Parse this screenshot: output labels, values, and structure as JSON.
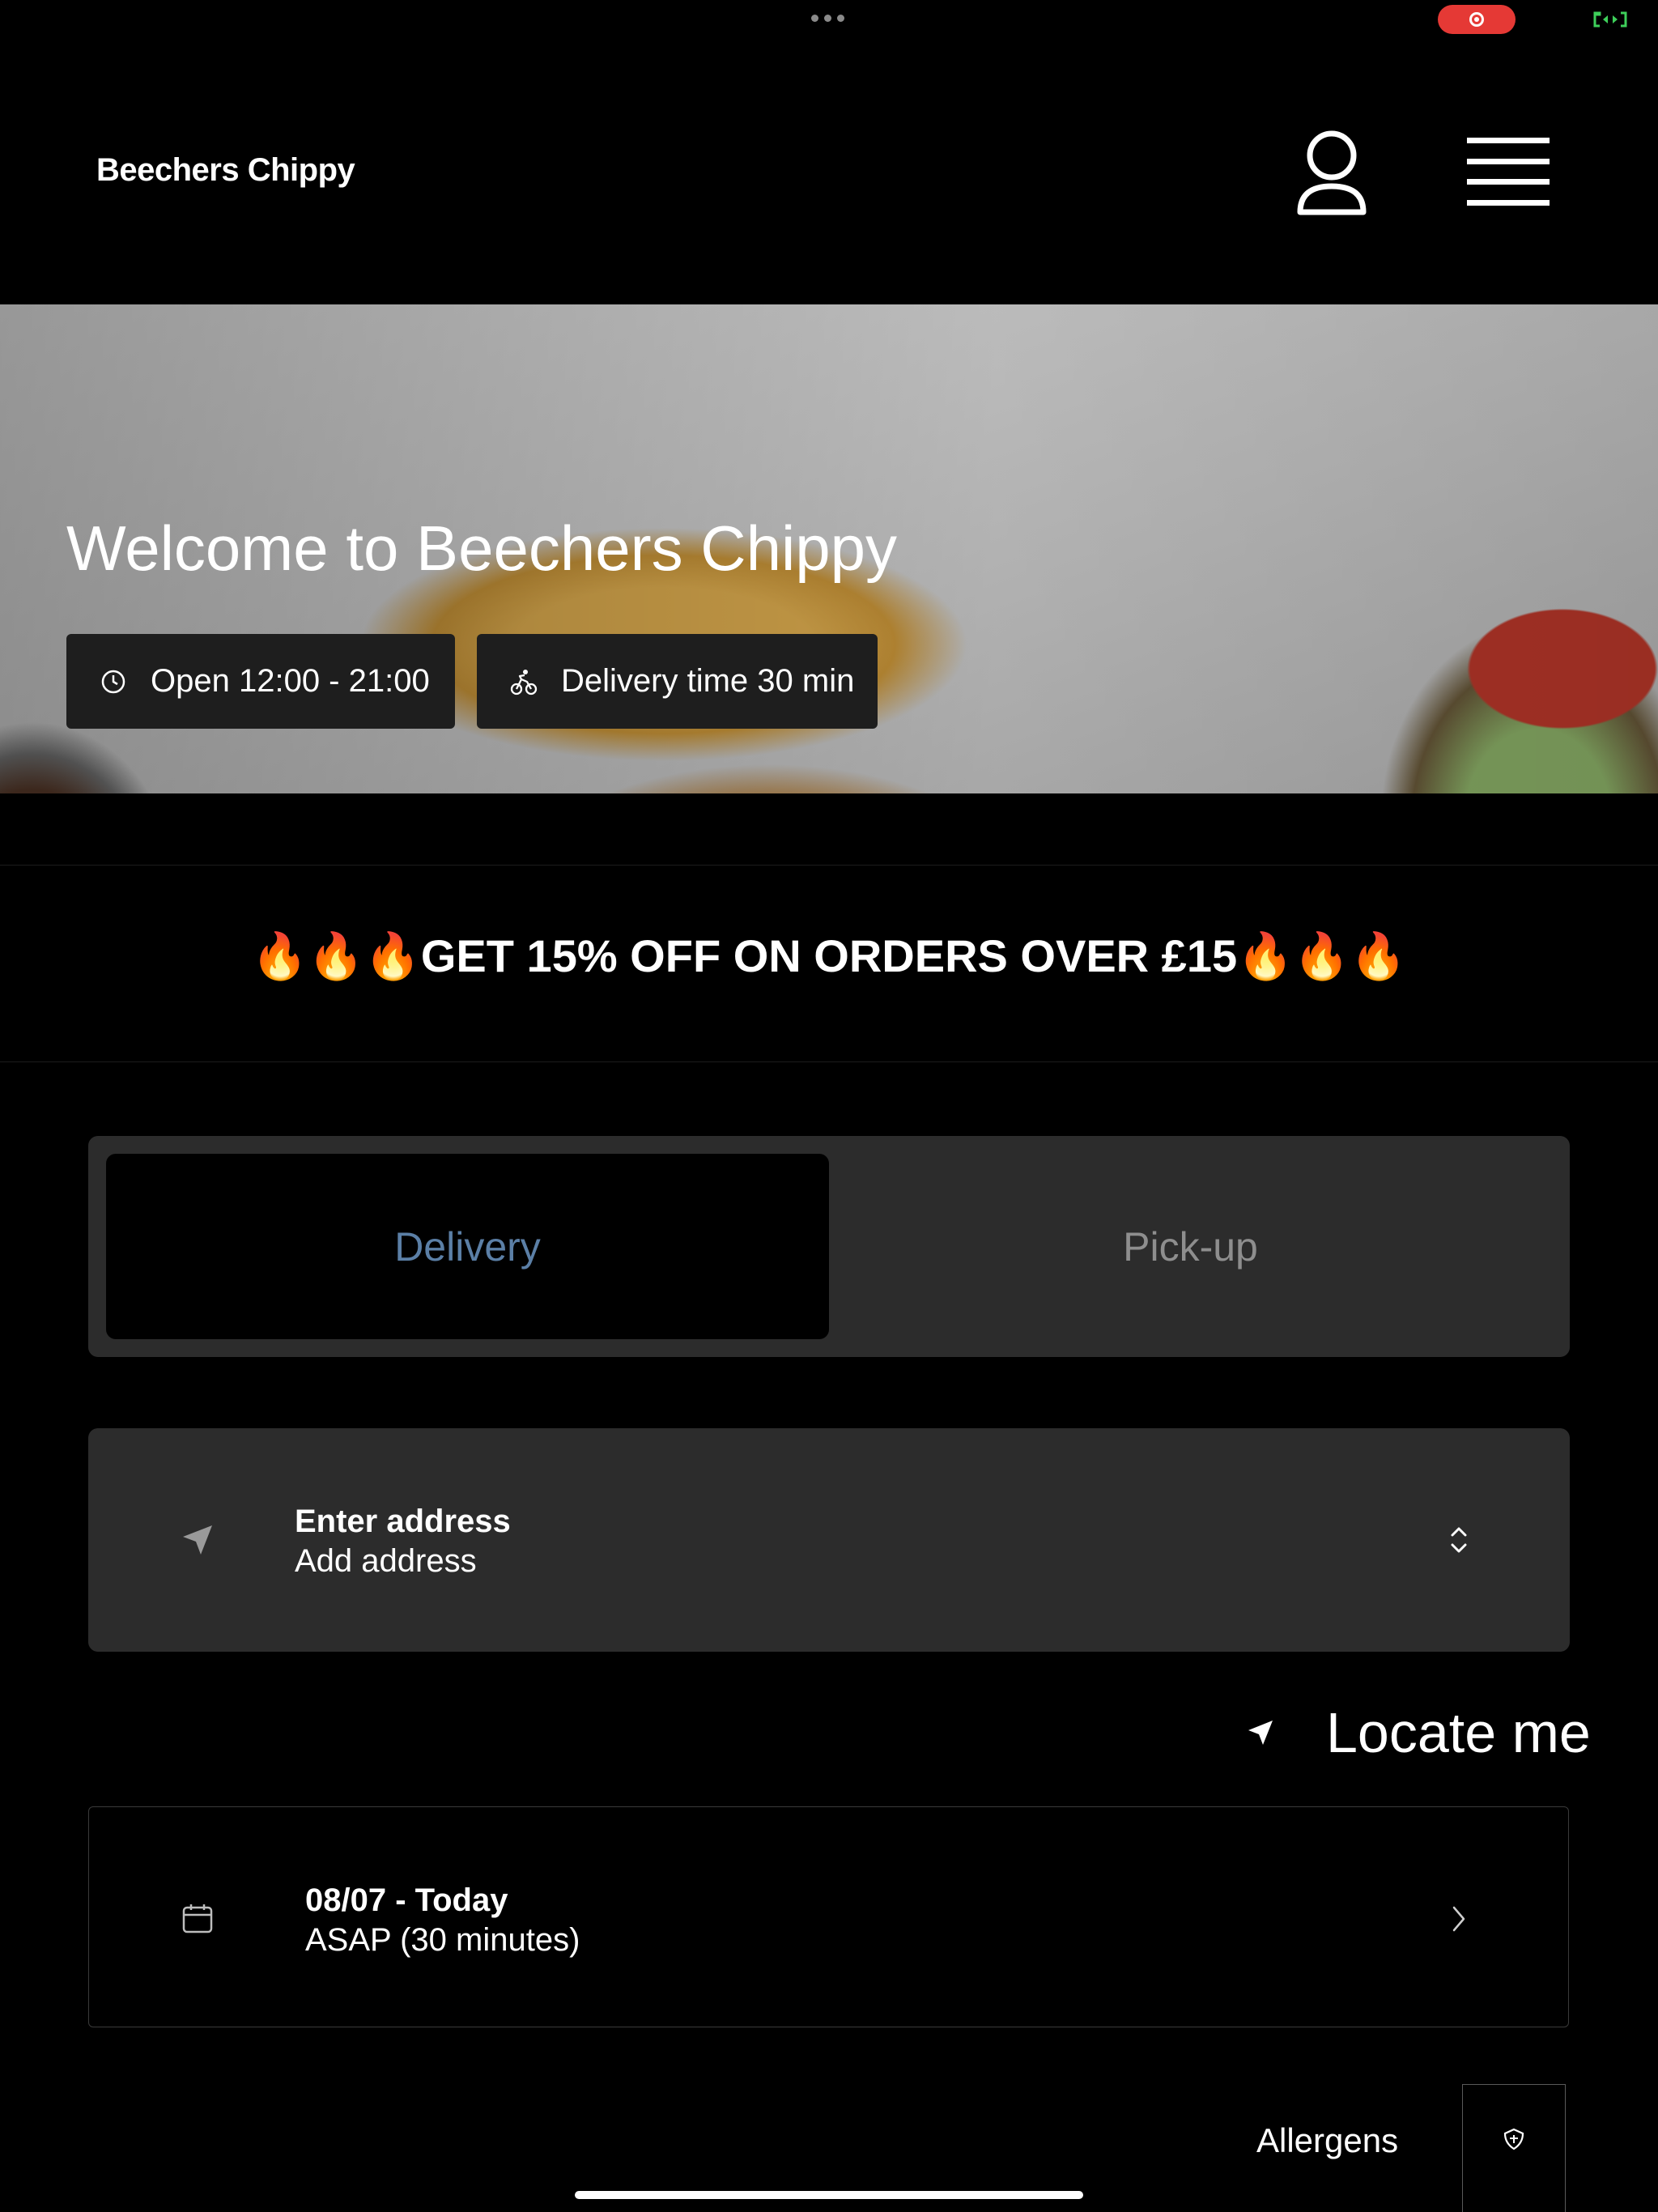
{
  "header": {
    "brand": "Beechers Chippy",
    "icons": [
      "user-icon",
      "hamburger-menu-icon"
    ]
  },
  "hero": {
    "welcome": "Welcome to Beechers Chippy",
    "hours": "Open 12:00 - 21:00",
    "delivery_time": "Delivery time 30 min"
  },
  "promo": {
    "text": "🔥🔥🔥GET 15% OFF ON ORDERS OVER £15🔥🔥🔥"
  },
  "order_mode": {
    "tabs": [
      "Delivery",
      "Pick-up"
    ],
    "selected": "Delivery",
    "active_color": "#5b7fa6"
  },
  "address": {
    "title": "Enter address",
    "subtitle": "Add address"
  },
  "locate": {
    "label": "Locate me"
  },
  "schedule": {
    "date": "08/07 - Today",
    "time": "ASAP (30 minutes)"
  },
  "footer": {
    "allergens_label": "Allergens"
  }
}
